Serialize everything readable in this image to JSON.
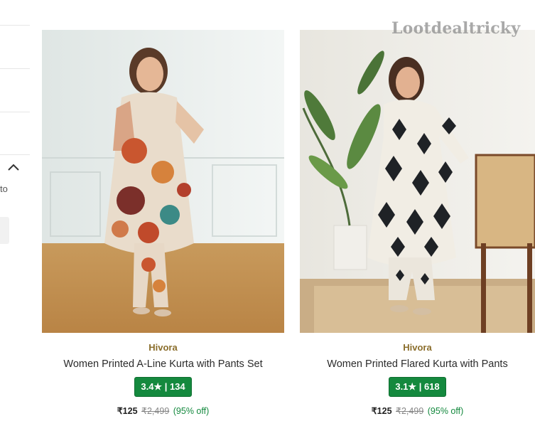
{
  "sidebar": {
    "truncated_text": "to"
  },
  "watermark": "Lootdealtricky",
  "products": [
    {
      "brand": "Hivora",
      "title": "Women Printed A-Line Kurta with Pants Set",
      "rating": "3.4★ | 134",
      "price": "₹125",
      "mrp": "₹2,499",
      "discount": "(95% off)"
    },
    {
      "brand": "Hivora",
      "title": "Women Printed Flared Kurta with Pants",
      "rating": "3.1★ | 618",
      "price": "₹125",
      "mrp": "₹2,499",
      "discount": "(95% off)"
    }
  ],
  "colors": {
    "rating_badge": "#14893e",
    "brand_text": "#8a6d2b",
    "discount_text": "#14893e"
  }
}
